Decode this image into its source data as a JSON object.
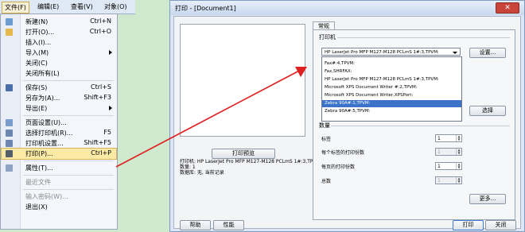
{
  "menubar": {
    "items": [
      {
        "label": "文件(F)",
        "active": true
      },
      {
        "label": "编辑(E)"
      },
      {
        "label": "查看(V)"
      },
      {
        "label": "对象(O)"
      }
    ]
  },
  "file_menu": {
    "items": [
      {
        "label": "新建(N)",
        "shortcut": "Ctrl+N",
        "icon": "new-document-icon",
        "color": "#6b9bd1"
      },
      {
        "label": "打开(O)...",
        "shortcut": "Ctrl+O",
        "icon": "open-folder-icon",
        "color": "#e6b84c"
      },
      {
        "label": "插入(I)...",
        "shortcut": "",
        "icon": "",
        "color": ""
      },
      {
        "label": "导入(M)",
        "shortcut": "",
        "icon": "",
        "color": "",
        "submenu": true
      },
      {
        "label": "关闭(C)",
        "shortcut": "",
        "icon": "",
        "color": ""
      },
      {
        "label": "关闭所有(L)",
        "shortcut": "",
        "icon": "",
        "color": ""
      },
      {
        "separator": true
      },
      {
        "label": "保存(S)",
        "shortcut": "Ctrl+S",
        "icon": "save-icon",
        "color": "#4a6fa8"
      },
      {
        "label": "另存为(A)...",
        "shortcut": "Shift+F3",
        "icon": "",
        "color": ""
      },
      {
        "label": "导出(E)",
        "shortcut": "",
        "icon": "",
        "color": "",
        "submenu": true
      },
      {
        "separator": true
      },
      {
        "label": "页面设置(U)...",
        "shortcut": "",
        "icon": "page-setup-icon",
        "color": "#7a9ccc"
      },
      {
        "label": "选择打印机(R)...",
        "shortcut": "F5",
        "icon": "select-printer-icon",
        "color": "#6b86b0"
      },
      {
        "label": "打印机设置...",
        "shortcut": "Shift+F5",
        "icon": "printer-settings-icon",
        "color": "#6b86b0"
      },
      {
        "label": "打印(P)...",
        "shortcut": "Ctrl+P",
        "icon": "print-icon",
        "color": "#555d6a",
        "highlight": true
      },
      {
        "separator": true
      },
      {
        "label": "属性(T)...",
        "shortcut": "",
        "icon": "properties-icon",
        "color": "#8fa4c2"
      },
      {
        "separator": true
      },
      {
        "label": "最近文件",
        "shortcut": "",
        "icon": "",
        "color": "",
        "disabled": true
      },
      {
        "separator": true
      },
      {
        "label": "输入密码(W)...",
        "shortcut": "",
        "icon": "",
        "color": "",
        "disabled": true
      },
      {
        "label": "退出(X)",
        "shortcut": "",
        "icon": "",
        "color": ""
      }
    ]
  },
  "print_dialog": {
    "title": "打印 - [Document1]",
    "close_glyph": "✕",
    "preview_button": "打印预览",
    "info_lines": [
      "打印机: HP LaserJet Pro MFP M127-M128 PCLmS 1#:3,TPVM:",
      "数量: 1",
      "数据库: 无, 当前记录"
    ],
    "tab_label": "常规",
    "printer_group": "打印机",
    "selected_printer": "HP LaserJet Pro MFP M127-M128 PCLmS 1#:3,TPVM:",
    "printer_options": [
      {
        "label": "Fax#:4,TPVM:"
      },
      {
        "label": "Fax,SHRFAX:"
      },
      {
        "label": "HP LaserJet Pro MFP M127-M128 PCLmS 1#:3,TPVM:"
      },
      {
        "label": "Microsoft XPS Document Writer #:2,TPVM:"
      },
      {
        "label": "Microsoft XPS Document Writer,XPSPort:"
      },
      {
        "label": "Zebra 90A#:1,TPVM:",
        "selected": true
      },
      {
        "label": "Zebra 90A#:5,TPVM:"
      }
    ],
    "settings_button": "设置...",
    "select_button": "选择",
    "quantity_group": "数量",
    "fields": [
      {
        "label": "标签",
        "value": "1",
        "disabled": false
      },
      {
        "label": "每个标签的打印份数",
        "value": "1",
        "disabled": true
      },
      {
        "label": "每页的打印份数",
        "value": "1",
        "disabled": false
      },
      {
        "label": "总数",
        "value": "1",
        "disabled": true
      }
    ],
    "more_button": "更多...",
    "help_button": "帮助",
    "performance_button": "性能",
    "print_button": "打印",
    "close_button": "关闭"
  }
}
